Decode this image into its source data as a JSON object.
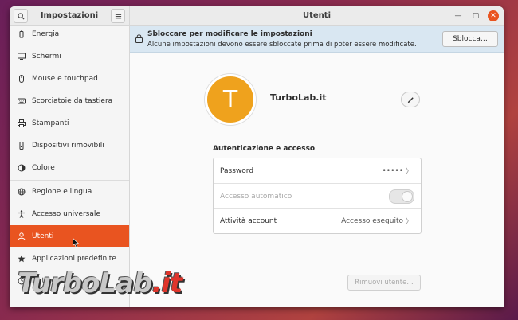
{
  "sidebar": {
    "title": "Impostazioni",
    "items": [
      {
        "label": "Energia",
        "icon": "battery-icon"
      },
      {
        "label": "Schermi",
        "icon": "display-icon"
      },
      {
        "label": "Mouse e touchpad",
        "icon": "mouse-icon"
      },
      {
        "label": "Scorciatoie da tastiera",
        "icon": "keyboard-icon"
      },
      {
        "label": "Stampanti",
        "icon": "printer-icon"
      },
      {
        "label": "Dispositivi rimovibili",
        "icon": "usb-drive-icon"
      },
      {
        "label": "Colore",
        "icon": "color-icon"
      },
      {
        "label": "Regione e lingua",
        "icon": "globe-icon"
      },
      {
        "label": "Accesso universale",
        "icon": "accessibility-icon"
      },
      {
        "label": "Utenti",
        "icon": "user-icon"
      },
      {
        "label": "Applicazioni predefinite",
        "icon": "star-icon"
      },
      {
        "label": "Data e ora",
        "icon": "clock-icon"
      }
    ]
  },
  "header": {
    "title": "Utenti"
  },
  "infobar": {
    "title": "Sbloccare per modificare le impostazioni",
    "subtitle": "Alcune impostazioni devono essere sbloccate prima di poter essere modificate.",
    "button": "Sblocca…"
  },
  "user": {
    "avatar_letter": "T",
    "name": "TurboLab.it"
  },
  "auth": {
    "section_title": "Autenticazione e accesso",
    "password_label": "Password",
    "password_value": "•••••",
    "autologin_label": "Accesso automatico",
    "activity_label": "Attività account",
    "activity_value": "Accesso eseguito"
  },
  "remove_button": "Rimuovi utente…",
  "watermark": {
    "part1": "TurboLab",
    "part2": ".it"
  },
  "colors": {
    "accent": "#e95420",
    "avatar": "#efa21d",
    "infobar": "#d9e7f2"
  }
}
